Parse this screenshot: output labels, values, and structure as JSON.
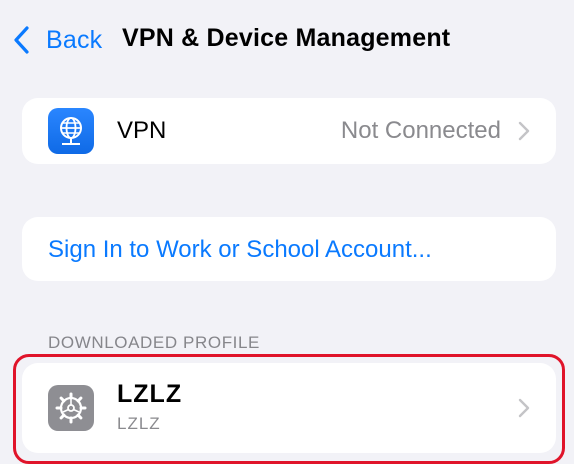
{
  "nav": {
    "back_label": "Back",
    "title": "VPN & Device Management"
  },
  "vpn_row": {
    "icon": "vpn-globe-icon",
    "label": "VPN",
    "status": "Not Connected"
  },
  "sign_in": {
    "label": "Sign In to Work or School Account..."
  },
  "downloaded_profile": {
    "header": "DOWNLOADED PROFILE",
    "items": [
      {
        "icon": "settings-gear-icon",
        "name": "LZLZ",
        "subtitle": "LZLZ"
      }
    ]
  },
  "colors": {
    "accent": "#0a7aff",
    "background": "#f2f2f7",
    "highlight": "#e0142a",
    "secondary_text": "#8a8a8e"
  }
}
